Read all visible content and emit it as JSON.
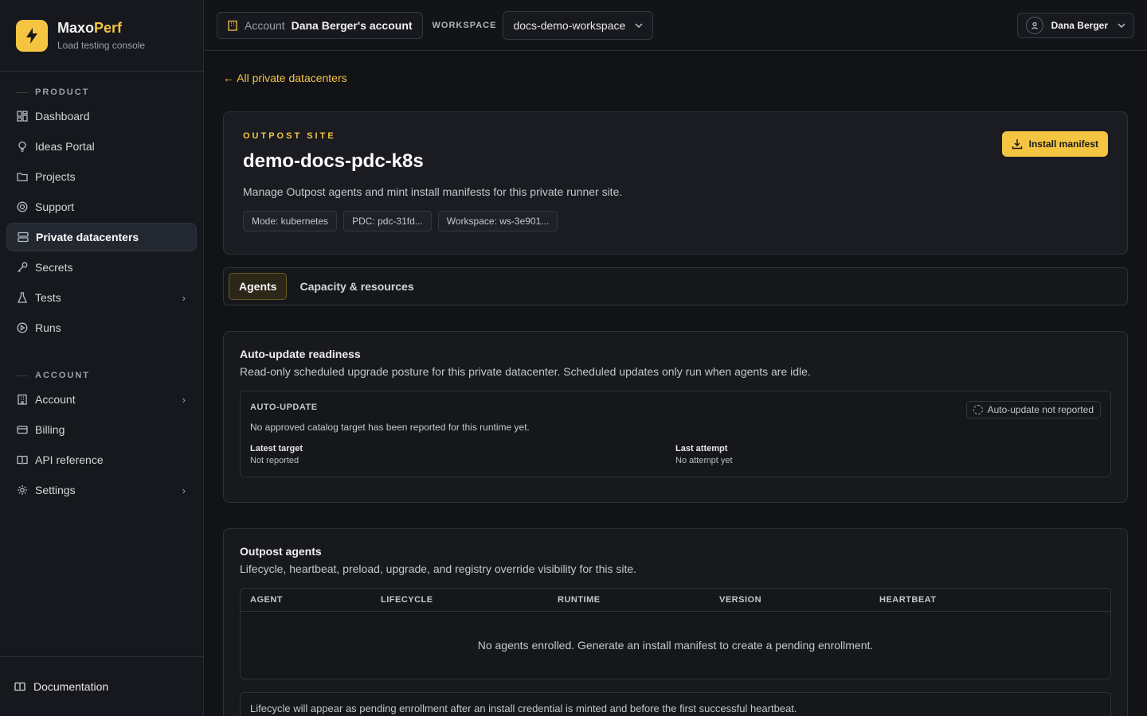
{
  "brand": {
    "name_main": "Maxo",
    "name_accent": "Perf",
    "subtitle": "Load testing console"
  },
  "sidebar": {
    "product_heading": "PRODUCT",
    "product_items": [
      {
        "label": "Dashboard",
        "icon": "dashboard-icon"
      },
      {
        "label": "Ideas Portal",
        "icon": "lightbulb-icon"
      },
      {
        "label": "Projects",
        "icon": "folder-icon"
      },
      {
        "label": "Support",
        "icon": "lifebuoy-icon"
      },
      {
        "label": "Private datacenters",
        "icon": "server-icon",
        "active": true
      },
      {
        "label": "Secrets",
        "icon": "key-icon"
      },
      {
        "label": "Tests",
        "icon": "flask-icon",
        "expandable": true
      },
      {
        "label": "Runs",
        "icon": "play-circle-icon"
      }
    ],
    "account_heading": "ACCOUNT",
    "account_items": [
      {
        "label": "Account",
        "icon": "building-icon",
        "expandable": true
      },
      {
        "label": "Billing",
        "icon": "credit-card-icon"
      },
      {
        "label": "API reference",
        "icon": "book-open-icon"
      },
      {
        "label": "Settings",
        "icon": "gear-icon",
        "expandable": true
      }
    ],
    "documentation": "Documentation"
  },
  "topbar": {
    "account_label": "Account",
    "account_name": "Dana Berger's account",
    "workspace_label": "WORKSPACE",
    "workspace_value": "docs-demo-workspace",
    "user_name": "Dana Berger"
  },
  "page": {
    "back_link": "← All private datacenters",
    "eyebrow": "OUTPOST SITE",
    "title": "demo-docs-pdc-k8s",
    "description": "Manage Outpost agents and mint install manifests for this private runner site.",
    "tags": [
      "Mode: kubernetes",
      "PDC: pdc-31fd...",
      "Workspace: ws-3e901..."
    ],
    "install_button": "Install manifest",
    "tabs": [
      {
        "label": "Agents",
        "active": true
      },
      {
        "label": "Capacity & resources",
        "active": false
      }
    ]
  },
  "auto_update": {
    "title": "Auto-update readiness",
    "description": "Read-only scheduled upgrade posture for this private datacenter. Scheduled updates only run when agents are idle.",
    "section_label": "AUTO-UPDATE",
    "status_badge": "Auto-update not reported",
    "message": "No approved catalog target has been reported for this runtime yet.",
    "latest_target_label": "Latest target",
    "latest_target_value": "Not reported",
    "last_attempt_label": "Last attempt",
    "last_attempt_value": "No attempt yet"
  },
  "agents": {
    "title": "Outpost agents",
    "description": "Lifecycle, heartbeat, preload, upgrade, and registry override visibility for this site.",
    "columns": [
      "AGENT",
      "LIFECYCLE",
      "RUNTIME",
      "VERSION",
      "HEARTBEAT"
    ],
    "empty_message": "No agents enrolled. Generate an install manifest to create a pending enrollment.",
    "note": "Lifecycle will appear as pending enrollment after an install credential is minted and before the first successful heartbeat."
  },
  "colors": {
    "accent": "#f5c542",
    "background": "#111317"
  }
}
